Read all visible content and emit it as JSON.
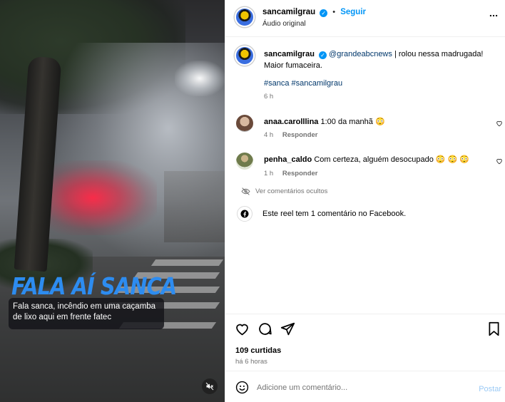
{
  "video": {
    "overlay_title": "FALA AÍ SANCA",
    "caption": "Fala sanca, incêndio em uma caçamba de lixo aqui em frente fatec"
  },
  "header": {
    "username": "sancamilgrau",
    "separator": "•",
    "follow_label": "Seguir",
    "audio_label": "Áudio original"
  },
  "post": {
    "username": "sancamilgrau",
    "mention": "@grandeabcnews",
    "text": " | rolou nessa madrugada! Maior fumaceira.",
    "hashtags": "#sanca #sancamilgrau",
    "time": "6 h"
  },
  "comments": [
    {
      "username": "anaa.carolllina",
      "text": "1:00 da manhã 😳",
      "time": "4 h",
      "reply_label": "Responder"
    },
    {
      "username": "penha_caldo",
      "text": "Com certeza, alguém desocupado 😳 😳 😳",
      "time": "1 h",
      "reply_label": "Responder"
    }
  ],
  "hidden_comments_label": "Ver comentários ocultos",
  "facebook_note": "Este reel tem 1 comentário no Facebook.",
  "likes": "109 curtidas",
  "post_age": "há 6 horas",
  "add_comment": {
    "placeholder": "Adicione um comentário...",
    "post_label": "Postar"
  },
  "colors": {
    "accent": "#0095f6",
    "overlay_title": "#2d8cf0",
    "post_disabled": "#9bcaf5"
  }
}
